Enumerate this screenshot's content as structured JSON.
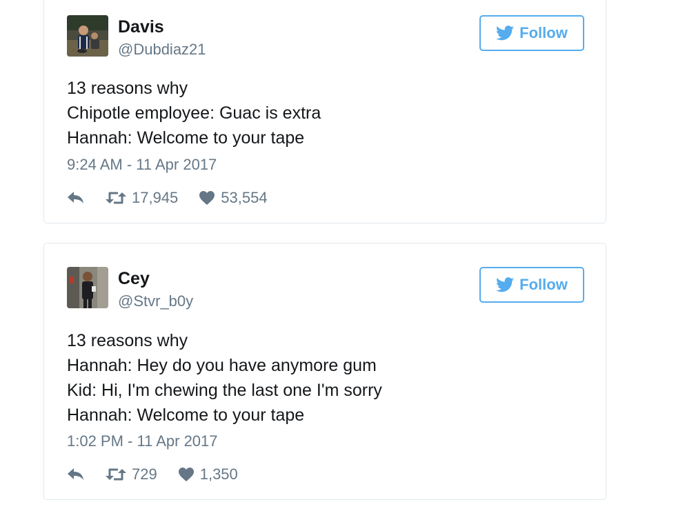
{
  "tweets": [
    {
      "author_name": "Davis",
      "author_handle": "@Dubdiaz21",
      "follow_label": "Follow",
      "text_lines": [
        "13 reasons why",
        "Chipotle employee: Guac is extra",
        "Hannah: Welcome to your tape"
      ],
      "timestamp": "9:24 AM - 11 Apr 2017",
      "retweets": "17,945",
      "likes": "53,554"
    },
    {
      "author_name": "Cey",
      "author_handle": "@Stvr_b0y",
      "follow_label": "Follow",
      "text_lines": [
        "13 reasons why",
        "Hannah: Hey do you have anymore gum",
        "Kid: Hi, I'm chewing the last one I'm sorry",
        "Hannah: Welcome to your tape"
      ],
      "timestamp": "1:02 PM - 11 Apr 2017",
      "retweets": "729",
      "likes": "1,350"
    }
  ],
  "colors": {
    "accent": "#55acee",
    "secondary_text": "#657786",
    "primary_text": "#14171a",
    "border": "#e1e8ed"
  },
  "icons": {
    "follow": "twitter-bird-icon",
    "reply": "reply-icon",
    "retweet": "retweet-icon",
    "like": "heart-icon"
  }
}
